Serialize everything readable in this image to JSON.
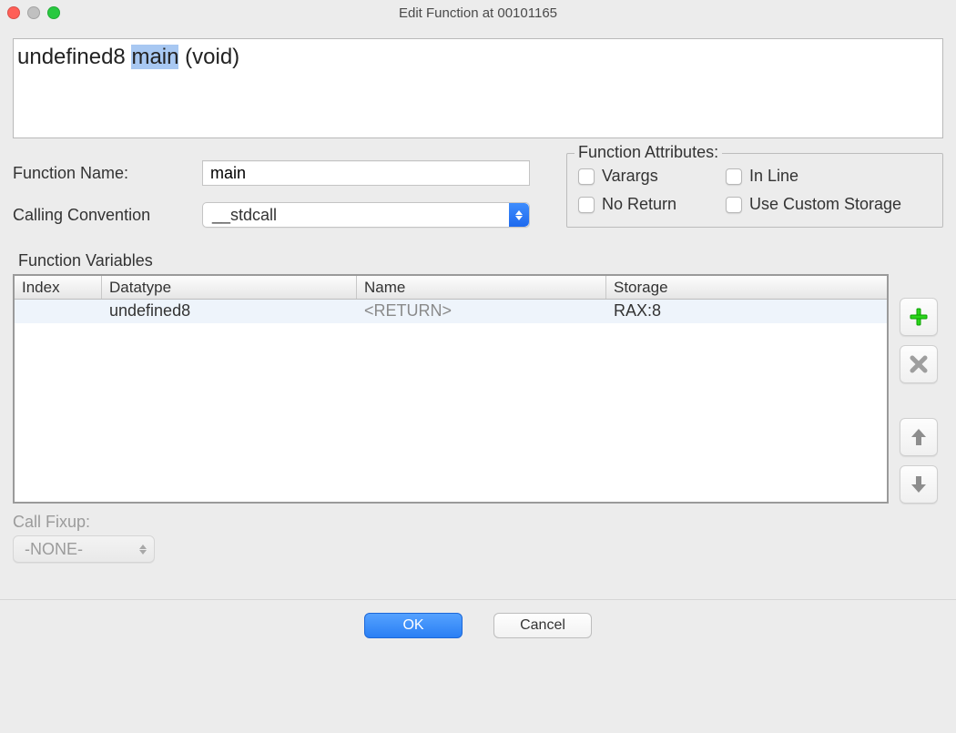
{
  "window": {
    "title": "Edit Function at 00101165"
  },
  "signature": {
    "prefix": "undefined8 ",
    "name": "main",
    "suffix": " (void)"
  },
  "form": {
    "function_name_label": "Function Name:",
    "function_name_value": "main",
    "calling_convention_label": "Calling Convention",
    "calling_convention_value": "__stdcall"
  },
  "attributes": {
    "legend": "Function Attributes:",
    "varargs_label": "Varargs",
    "inline_label": "In Line",
    "noreturn_label": "No Return",
    "custom_storage_label": "Use Custom Storage"
  },
  "vars": {
    "section_label": "Function Variables",
    "headers": {
      "index": "Index",
      "datatype": "Datatype",
      "name": "Name",
      "storage": "Storage"
    },
    "rows": [
      {
        "index": "",
        "datatype": "undefined8",
        "name": "<RETURN>",
        "storage": "RAX:8"
      }
    ]
  },
  "call_fixup": {
    "label": "Call Fixup:",
    "value": "-NONE-"
  },
  "footer": {
    "ok": "OK",
    "cancel": "Cancel"
  },
  "icons": {
    "add": "add-icon",
    "remove": "remove-icon",
    "up": "up-arrow-icon",
    "down": "down-arrow-icon"
  }
}
